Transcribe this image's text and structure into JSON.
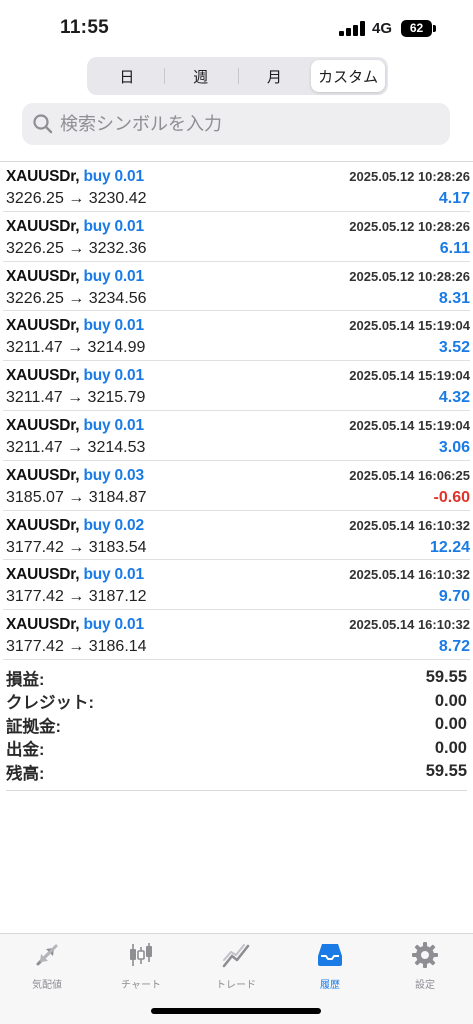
{
  "status_bar": {
    "time": "11:55",
    "network": "4G",
    "battery": "62"
  },
  "segmented": [
    {
      "label": "日"
    },
    {
      "label": "週"
    },
    {
      "label": "月"
    },
    {
      "label": "カスタム"
    }
  ],
  "search": {
    "placeholder": "検索シンボルを入力"
  },
  "deals": [
    {
      "symbol": "XAUUSDr,",
      "side": "buy 0.01",
      "time": "2025.05.12 10:28:26",
      "prices": "3226.25 → 3230.42",
      "profit": "4.17"
    },
    {
      "symbol": "XAUUSDr,",
      "side": "buy 0.01",
      "time": "2025.05.12 10:28:26",
      "prices": "3226.25 → 3232.36",
      "profit": "6.11"
    },
    {
      "symbol": "XAUUSDr,",
      "side": "buy 0.01",
      "time": "2025.05.12 10:28:26",
      "prices": "3226.25 → 3234.56",
      "profit": "8.31"
    },
    {
      "symbol": "XAUUSDr,",
      "side": "buy 0.01",
      "time": "2025.05.14 15:19:04",
      "prices": "3211.47 → 3214.99",
      "profit": "3.52"
    },
    {
      "symbol": "XAUUSDr,",
      "side": "buy 0.01",
      "time": "2025.05.14 15:19:04",
      "prices": "3211.47 → 3215.79",
      "profit": "4.32"
    },
    {
      "symbol": "XAUUSDr,",
      "side": "buy 0.01",
      "time": "2025.05.14 15:19:04",
      "prices": "3211.47 → 3214.53",
      "profit": "3.06"
    },
    {
      "symbol": "XAUUSDr,",
      "side": "buy 0.03",
      "time": "2025.05.14 16:06:25",
      "prices": "3185.07 → 3184.87",
      "profit": "-0.60"
    },
    {
      "symbol": "XAUUSDr,",
      "side": "buy 0.02",
      "time": "2025.05.14 16:10:32",
      "prices": "3177.42 → 3183.54",
      "profit": "12.24"
    },
    {
      "symbol": "XAUUSDr,",
      "side": "buy 0.01",
      "time": "2025.05.14 16:10:32",
      "prices": "3177.42 → 3187.12",
      "profit": "9.70"
    },
    {
      "symbol": "XAUUSDr,",
      "side": "buy 0.01",
      "time": "2025.05.14 16:10:32",
      "prices": "3177.42 → 3186.14",
      "profit": "8.72"
    }
  ],
  "summary": {
    "profit": {
      "label": "損益:",
      "value": "59.55"
    },
    "credit": {
      "label": "クレジット:",
      "value": "0.00"
    },
    "margin": {
      "label": "証拠金:",
      "value": "0.00"
    },
    "withdrawal": {
      "label": "出金:",
      "value": "0.00"
    },
    "balance": {
      "label": "残高:",
      "value": "59.55"
    }
  },
  "tabbar": [
    {
      "label": "気配値",
      "icon": "quotes-arrows-icon"
    },
    {
      "label": "チャート",
      "icon": "candlestick-chart-icon"
    },
    {
      "label": "トレード",
      "icon": "trade-line-icon"
    },
    {
      "label": "履歴",
      "icon": "history-inbox-icon"
    },
    {
      "label": "設定",
      "icon": "gear-icon"
    }
  ],
  "colors": {
    "accent": "#1a7be6",
    "negative": "#e0342b",
    "inactive": "#8e8e93"
  }
}
